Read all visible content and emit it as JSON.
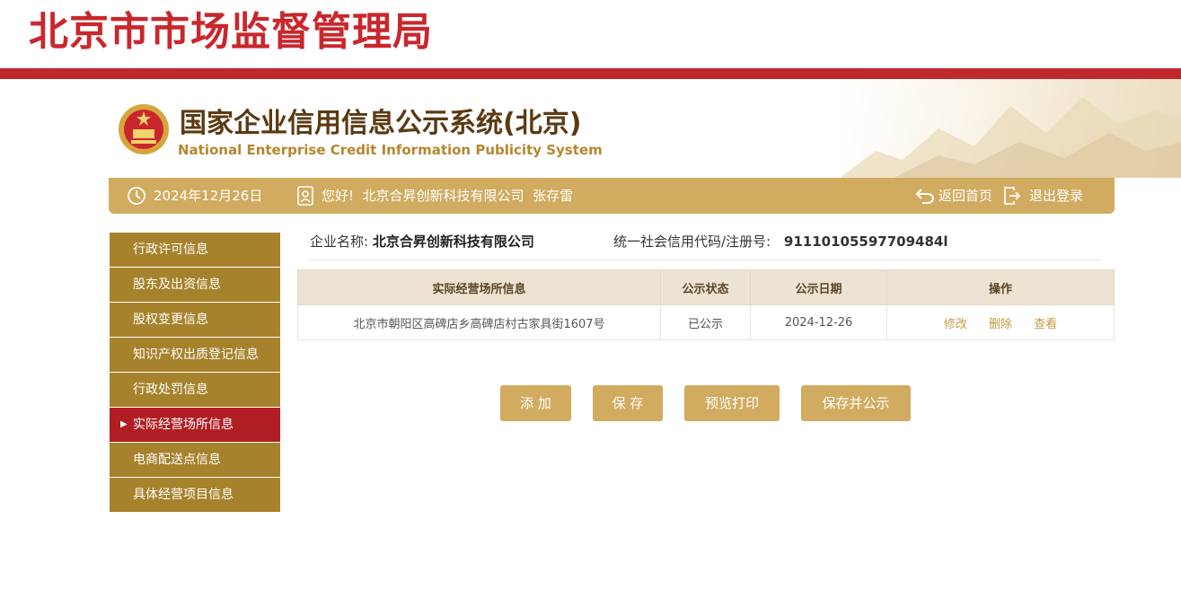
{
  "header": {
    "agency_title": "北京市市场监督管理局",
    "system_title": "国家企业信用信息公示系统(北京)",
    "system_subtitle": "National Enterprise Credit Information Publicity System"
  },
  "infobar": {
    "date": "2024年12月26日",
    "greeting": "您好!  北京合昇创新科技有限公司  张存雷",
    "back_home": "返回首页",
    "logout": "退出登录"
  },
  "sidebar": {
    "items": [
      {
        "label": "行政许可信息",
        "active": false
      },
      {
        "label": "股东及出资信息",
        "active": false
      },
      {
        "label": "股权变更信息",
        "active": false
      },
      {
        "label": "知识产权出质登记信息",
        "active": false
      },
      {
        "label": "行政处罚信息",
        "active": false
      },
      {
        "label": "实际经营场所信息",
        "active": true
      },
      {
        "label": "电商配送点信息",
        "active": false
      },
      {
        "label": "具体经营项目信息",
        "active": false
      }
    ]
  },
  "company": {
    "name_label": "企业名称:",
    "name": "北京合昇创新科技有限公司",
    "code_label": "统一社会信用代码/注册号:",
    "code": "91110105597709484l"
  },
  "table": {
    "headers": [
      "实际经营场所信息",
      "公示状态",
      "公示日期",
      "操作"
    ],
    "rows": [
      {
        "address": "北京市朝阳区高碑店乡高碑店村古家具街1607号",
        "status": "已公示",
        "date": "2024-12-26"
      }
    ],
    "ops": [
      "修改",
      "删除",
      "查看"
    ]
  },
  "buttons": {
    "add": "添 加",
    "save": "保 存",
    "preview": "预览打印",
    "save_publish": "保存并公示"
  },
  "colors": {
    "brand_red": "#c0282e",
    "gold": "#d1ab5f",
    "sidebar_gold": "#a7822c",
    "sidebar_active": "#b01e24"
  }
}
